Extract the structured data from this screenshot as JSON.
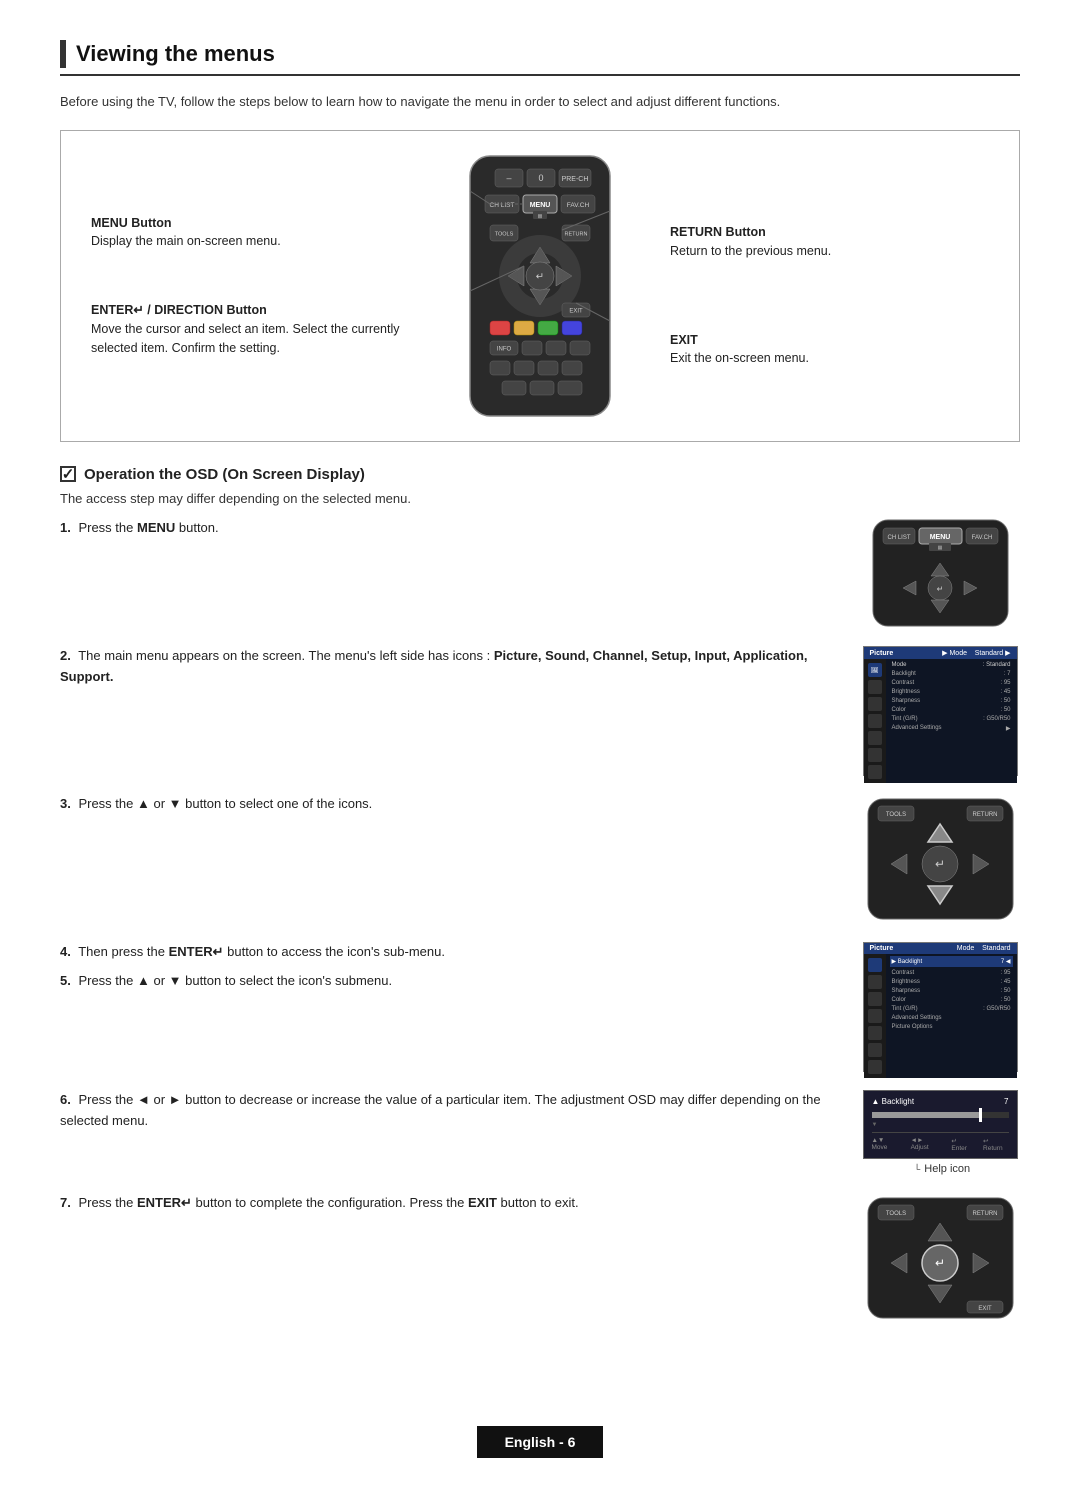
{
  "page": {
    "title": "Viewing the menus",
    "intro": "Before using the TV, follow the steps below to learn how to navigate the menu in order to select and adjust different functions.",
    "diagram": {
      "menu_button_label": "MENU Button",
      "menu_button_desc": "Display the main on-screen menu.",
      "enter_button_label": "ENTER / DIRECTION Button",
      "enter_button_desc": "Move the cursor and select an item. Select the currently selected item. Confirm the setting.",
      "return_button_label": "RETURN Button",
      "return_button_desc": "Return to the previous menu.",
      "exit_label": "EXIT",
      "exit_desc": "Exit the on-screen menu."
    },
    "osd": {
      "title": "Operation the OSD (On Screen Display)",
      "desc": "The access step may differ depending on the selected menu.",
      "steps": [
        {
          "num": "1",
          "text": "Press the MENU button.",
          "has_image": true,
          "image_type": "remote_top"
        },
        {
          "num": "2",
          "text": "The main menu appears on the screen. The menu's left side has icons : Picture, Sound, Channel, Setup, Input, Application, Support.",
          "has_image": true,
          "image_type": "tv_menu"
        },
        {
          "num": "3",
          "text": "Press the ▲ or ▼ button to select one of the icons.",
          "has_image": true,
          "image_type": "remote_dpad"
        },
        {
          "num": "4",
          "text": "Then press the ENTER button to access the icon's sub-menu.",
          "has_image": false
        },
        {
          "num": "5",
          "text": "Press the ▲ or ▼ button to select the icon's submenu.",
          "has_image": true,
          "image_type": "tv_submenu"
        },
        {
          "num": "6",
          "text": "Press the ◄ or ► button to decrease or increase the value of a particular item. The adjustment OSD may differ depending on the selected menu.",
          "has_image": true,
          "image_type": "backlight_bar"
        },
        {
          "num": "7",
          "text": "Press the ENTER button to complete the configuration. Press the EXIT button to exit.",
          "has_image": true,
          "image_type": "remote_dpad2"
        }
      ]
    },
    "footer": {
      "text": "English - 6"
    }
  }
}
